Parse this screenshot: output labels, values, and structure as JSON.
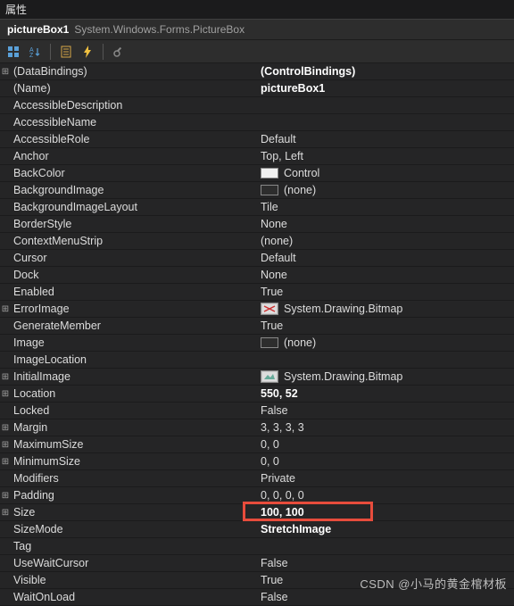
{
  "title": "属性",
  "header": {
    "object_name": "pictureBox1",
    "object_type": "System.Windows.Forms.PictureBox"
  },
  "toolbar": {
    "categorize": "categorize",
    "alphabetical": "alphabetical",
    "properties": "properties",
    "events": "events",
    "property_pages": "property-pages"
  },
  "rows": [
    {
      "exp": "⊞",
      "name": "(DataBindings)",
      "value": "(ControlBindings)",
      "bold": true
    },
    {
      "exp": "",
      "name": "(Name)",
      "value": "pictureBox1",
      "bold": true
    },
    {
      "exp": "",
      "name": "AccessibleDescription",
      "value": ""
    },
    {
      "exp": "",
      "name": "AccessibleName",
      "value": ""
    },
    {
      "exp": "",
      "name": "AccessibleRole",
      "value": "Default"
    },
    {
      "exp": "",
      "name": "Anchor",
      "value": "Top, Left"
    },
    {
      "exp": "",
      "name": "BackColor",
      "value": "Control",
      "swatch": "control"
    },
    {
      "exp": "",
      "name": "BackgroundImage",
      "value": "(none)",
      "swatch": "none"
    },
    {
      "exp": "",
      "name": "BackgroundImageLayout",
      "value": "Tile"
    },
    {
      "exp": "",
      "name": "BorderStyle",
      "value": "None"
    },
    {
      "exp": "",
      "name": "ContextMenuStrip",
      "value": "(none)"
    },
    {
      "exp": "",
      "name": "Cursor",
      "value": "Default"
    },
    {
      "exp": "",
      "name": "Dock",
      "value": "None"
    },
    {
      "exp": "",
      "name": "Enabled",
      "value": "True"
    },
    {
      "exp": "⊞",
      "name": "ErrorImage",
      "value": "System.Drawing.Bitmap",
      "thumb": "error"
    },
    {
      "exp": "",
      "name": "GenerateMember",
      "value": "True"
    },
    {
      "exp": "",
      "name": "Image",
      "value": "(none)",
      "swatch": "none"
    },
    {
      "exp": "",
      "name": "ImageLocation",
      "value": ""
    },
    {
      "exp": "⊞",
      "name": "InitialImage",
      "value": "System.Drawing.Bitmap",
      "thumb": "initial"
    },
    {
      "exp": "⊞",
      "name": "Location",
      "value": "550, 52",
      "bold": true
    },
    {
      "exp": "",
      "name": "Locked",
      "value": "False"
    },
    {
      "exp": "⊞",
      "name": "Margin",
      "value": "3, 3, 3, 3"
    },
    {
      "exp": "⊞",
      "name": "MaximumSize",
      "value": "0, 0"
    },
    {
      "exp": "⊞",
      "name": "MinimumSize",
      "value": "0, 0"
    },
    {
      "exp": "",
      "name": "Modifiers",
      "value": "Private"
    },
    {
      "exp": "⊞",
      "name": "Padding",
      "value": "0, 0, 0, 0"
    },
    {
      "exp": "⊞",
      "name": "Size",
      "value": "100, 100",
      "bold": true,
      "highlight": true
    },
    {
      "exp": "",
      "name": "SizeMode",
      "value": "StretchImage",
      "bold": true
    },
    {
      "exp": "",
      "name": "Tag",
      "value": ""
    },
    {
      "exp": "",
      "name": "UseWaitCursor",
      "value": "False"
    },
    {
      "exp": "",
      "name": "Visible",
      "value": "True"
    },
    {
      "exp": "",
      "name": "WaitOnLoad",
      "value": "False"
    }
  ],
  "watermark": "CSDN @小马的黄金棺材板"
}
